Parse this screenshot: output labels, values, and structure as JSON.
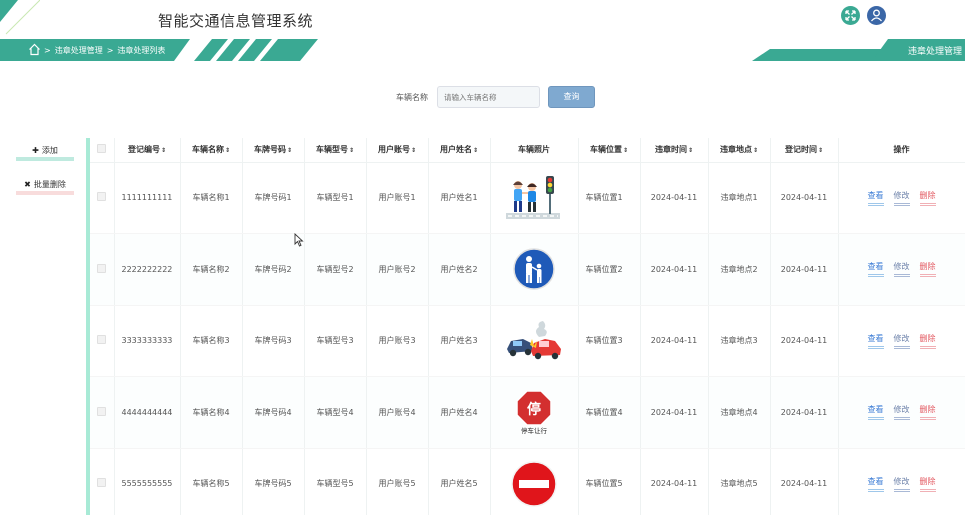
{
  "header": {
    "title": "智能交通信息管理系统",
    "breadcrumb": [
      "违章处理管理",
      "违章处理列表"
    ],
    "section_label": "违章处理管理",
    "accent_color": "#3aa993",
    "icons": [
      "fullscreen-icon",
      "user-avatar-icon"
    ]
  },
  "search": {
    "label": "车辆名称",
    "placeholder": "请输入车辆名称",
    "button_label": "查询"
  },
  "actions": {
    "add_label": "添加",
    "batch_delete_label": "批量删除"
  },
  "table": {
    "columns": [
      "登记编号",
      "车辆名称",
      "车牌号码",
      "车辆型号",
      "用户账号",
      "用户姓名",
      "车辆照片",
      "车辆位置",
      "违章时间",
      "违章地点",
      "登记时间",
      "操作"
    ],
    "rows": [
      {
        "id": "1111111111",
        "name": "车辆名称1",
        "plate": "车牌号码1",
        "model": "车辆型号1",
        "account": "用户账号1",
        "username": "用户姓名1",
        "photo": "pedestrians-traffic-light-icon",
        "location": "车辆位置1",
        "time": "2024-04-11",
        "place": "违章地点1",
        "reg_time": "2024-04-11"
      },
      {
        "id": "2222222222",
        "name": "车辆名称2",
        "plate": "车牌号码2",
        "model": "车辆型号2",
        "account": "用户账号2",
        "username": "用户姓名2",
        "photo": "pedestrian-sign-icon",
        "location": "车辆位置2",
        "time": "2024-04-11",
        "place": "违章地点2",
        "reg_time": "2024-04-11"
      },
      {
        "id": "3333333333",
        "name": "车辆名称3",
        "plate": "车牌号码3",
        "model": "车辆型号3",
        "account": "用户账号3",
        "username": "用户姓名3",
        "photo": "car-crash-icon",
        "location": "车辆位置3",
        "time": "2024-04-11",
        "place": "违章地点3",
        "reg_time": "2024-04-11"
      },
      {
        "id": "4444444444",
        "name": "车辆名称4",
        "plate": "车牌号码4",
        "model": "车辆型号4",
        "account": "用户账号4",
        "username": "用户姓名4",
        "photo": "stop-sign-icon",
        "photo_caption": "停车让行",
        "photo_glyph": "停",
        "location": "车辆位置4",
        "time": "2024-04-11",
        "place": "违章地点4",
        "reg_time": "2024-04-11"
      },
      {
        "id": "5555555555",
        "name": "车辆名称5",
        "plate": "车牌号码5",
        "model": "车辆型号5",
        "account": "用户账号5",
        "username": "用户姓名5",
        "photo": "no-entry-sign-icon",
        "location": "车辆位置5",
        "time": "2024-04-11",
        "place": "违章地点5",
        "reg_time": "2024-04-11"
      }
    ],
    "row_actions": [
      "查看",
      "修改",
      "删除"
    ]
  }
}
